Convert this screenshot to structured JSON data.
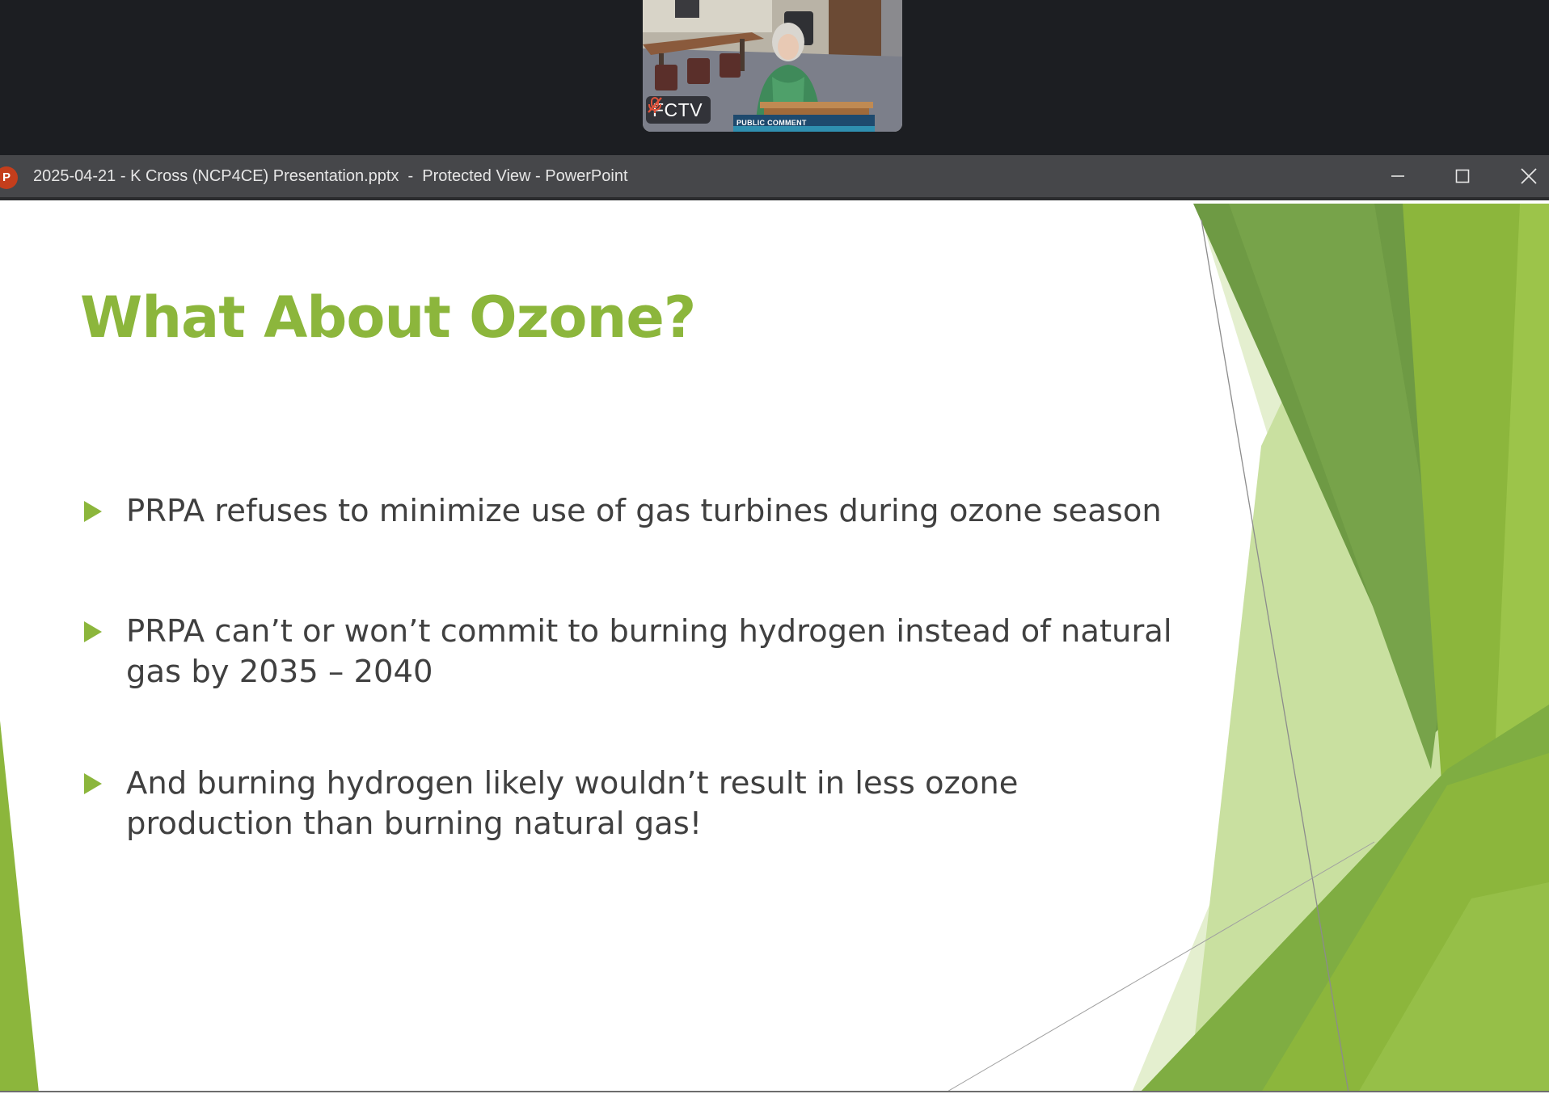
{
  "meeting": {
    "tile_name": "FCTV",
    "lower_third": "PUBLIC COMMENT",
    "mic_icon": "mic-muted-icon"
  },
  "window": {
    "app_icon_letter": "P",
    "title": "2025-04-21 - K Cross (NCP4CE) Presentation.pptx  -  Protected View - PowerPoint",
    "controls": [
      "minimize-icon",
      "maximize-icon",
      "close-icon"
    ]
  },
  "slide": {
    "title": "What About Ozone?",
    "bullets": [
      "PRPA refuses to minimize use of gas turbines during ozone season",
      "PRPA can’t or won’t commit to burning hydrogen instead of natural gas by 2035 – 2040",
      "And burning hydrogen likely wouldn’t result in less ozone production than burning natural gas!"
    ],
    "colors": {
      "title": "#8cb63c",
      "bullet_arrow": "#8cb63c",
      "body_text": "#404040",
      "green_dark": "#6e9a44",
      "green_mid": "#8cb63c",
      "green_light": "#c9e0a0"
    }
  }
}
